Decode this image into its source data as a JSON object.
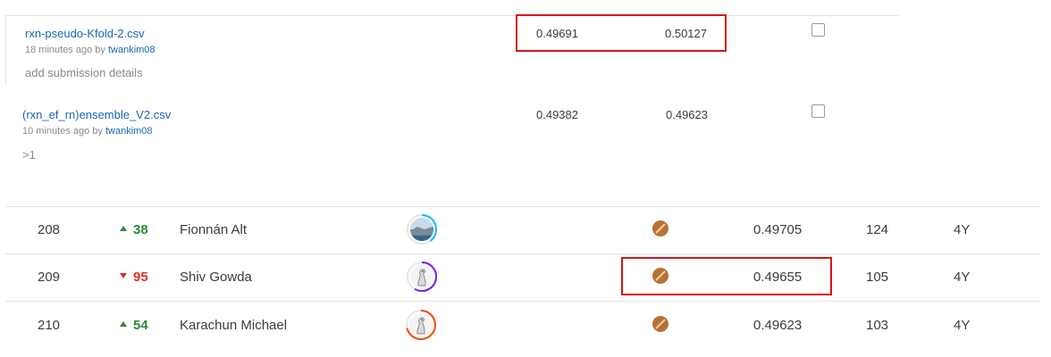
{
  "submissions": [
    {
      "name": "rxn-pseudo-Kfold-2.csv",
      "time_ago": "18 minutes ago by",
      "user": "twankim08",
      "details": "add submission details",
      "private_score": "0.49691",
      "public_score": "0.50127",
      "selected": false
    },
    {
      "name": "(rxn_ef_rn)ensemble_V2.csv",
      "time_ago": "10 minutes ago by",
      "user": "twankim08",
      "details": ">1",
      "private_score": "0.49382",
      "public_score": "0.49623",
      "selected": false
    }
  ],
  "leaderboard": [
    {
      "rank": "208",
      "delta": "38",
      "direction": "up",
      "team": "Fionnán Alt",
      "score": "0.49705",
      "entries": "124",
      "last": "4Y",
      "avatar": "landscape-photo",
      "ring_color": "#20beff",
      "medal": "bronze"
    },
    {
      "rank": "209",
      "delta": "95",
      "direction": "down",
      "team": "Shiv Gowda",
      "score": "0.49655",
      "entries": "105",
      "last": "4Y",
      "avatar": "default-goose",
      "ring_color": "#7a2cf2",
      "medal": "bronze"
    },
    {
      "rank": "210",
      "delta": "54",
      "direction": "up",
      "team": "Karachun Michael",
      "score": "0.49623",
      "entries": "103",
      "last": "4Y",
      "avatar": "default-goose",
      "ring_color": "#f0561d",
      "medal": "bronze"
    }
  ],
  "colors": {
    "highlight": "#d6161b",
    "link": "#1a64b7",
    "up": "#2b8a3e",
    "down": "#d93025",
    "medal": "#b87333"
  }
}
